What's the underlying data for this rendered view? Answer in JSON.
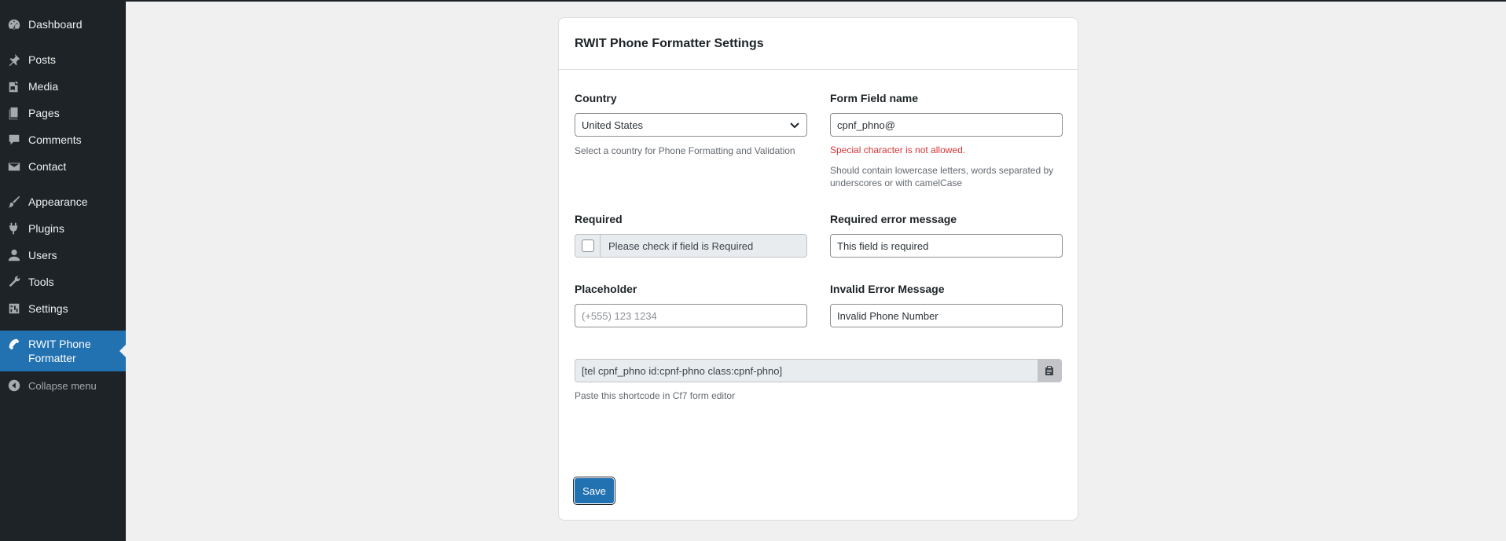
{
  "sidebar": {
    "items": [
      {
        "label": "Dashboard",
        "icon": "dashboard-icon"
      },
      {
        "label": "Posts",
        "icon": "pin-icon"
      },
      {
        "label": "Media",
        "icon": "media-icon"
      },
      {
        "label": "Pages",
        "icon": "pages-icon"
      },
      {
        "label": "Comments",
        "icon": "comment-icon"
      },
      {
        "label": "Contact",
        "icon": "mail-icon"
      },
      {
        "label": "Appearance",
        "icon": "brush-icon"
      },
      {
        "label": "Plugins",
        "icon": "plugin-icon"
      },
      {
        "label": "Users",
        "icon": "user-icon"
      },
      {
        "label": "Tools",
        "icon": "wrench-icon"
      },
      {
        "label": "Settings",
        "icon": "settings-icon"
      },
      {
        "label": "RWIT Phone Formatter",
        "icon": "phone-icon",
        "active": true
      },
      {
        "label": "Collapse menu",
        "icon": "collapse-icon"
      }
    ]
  },
  "card": {
    "title": "RWIT Phone Formatter Settings",
    "country": {
      "label": "Country",
      "value": "United States",
      "help": "Select a country for Phone Formatting and Validation"
    },
    "field_name": {
      "label": "Form Field name",
      "value": "cpnf_phno@",
      "error": "Special character is not allowed.",
      "help": "Should contain lowercase letters, words separated by underscores or with camelCase"
    },
    "required": {
      "label": "Required",
      "checkbox_label": "Please check if field is Required"
    },
    "required_error": {
      "label": "Required error message",
      "value": "This field is required"
    },
    "placeholder": {
      "label": "Placeholder",
      "placeholder": "(+555) 123 1234"
    },
    "invalid_error": {
      "label": "Invalid Error Message",
      "value": "Invalid Phone Number"
    },
    "shortcode": {
      "value": "[tel cpnf_phno id:cpnf-phno class:cpnf-phno]",
      "help": "Paste this shortcode in Cf7 form editor"
    },
    "save_label": "Save"
  },
  "colors": {
    "sidebar_bg": "#1d2327",
    "active": "#2271b1",
    "error": "#d63638"
  }
}
